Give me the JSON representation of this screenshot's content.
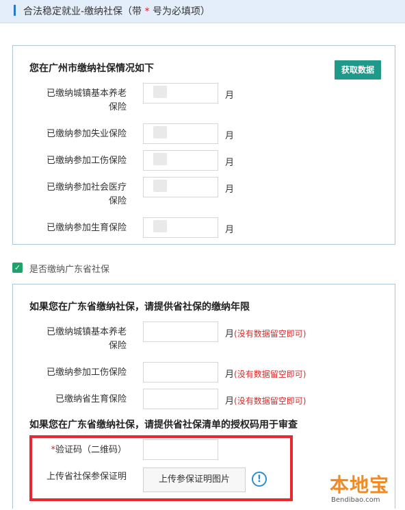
{
  "header": {
    "title_prefix": "合法稳定就业-缴纳社保（带",
    "title_star": "*",
    "title_suffix": "号为必填项）"
  },
  "guangzhou_section": {
    "title": "您在广州市缴纳社保情况如下",
    "fetch_button": "获取数据",
    "unit": "月",
    "rows": [
      {
        "label_line1": "已缴纳城镇基本养老",
        "label_line2": "保险"
      },
      {
        "label_line1": "已缴纳参加失业保险",
        "label_line2": ""
      },
      {
        "label_line1": "已缴纳参加工伤保险",
        "label_line2": ""
      },
      {
        "label_line1": "已缴纳参加社会医疗",
        "label_line2": "保险"
      },
      {
        "label_line1": "已缴纳参加生育保险",
        "label_line2": ""
      }
    ]
  },
  "province_checkbox": {
    "label": "是否缴纳广东省社保",
    "checked": true
  },
  "province_section": {
    "title": "如果您在广东省缴纳社保，请提供省社保的缴纳年限",
    "unit": "月",
    "hint": "(没有数据留空即可)",
    "rows": [
      {
        "label_line1": "已缴纳城镇基本养老",
        "label_line2": "保险"
      },
      {
        "label_line1": "已缴纳参加工伤保险",
        "label_line2": ""
      },
      {
        "label_line1": "已缴纳省生育保险",
        "label_line2": ""
      }
    ],
    "auth_title": "如果您在广东省缴纳社保，请提供省社保清单的授权码用于审查",
    "verify_star": "*",
    "verify_label": "验证码（二维码）",
    "upload_label": "上传省社保参保证明",
    "upload_button": "上传参保证明图片",
    "info_icon": "!"
  },
  "watermark": {
    "brand": "本地宝",
    "url": "Bendibao.com"
  },
  "colors": {
    "accent": "#2a78c8",
    "fetch_button": "#1f9a8a",
    "checkbox": "#22a26b",
    "highlight_box": "#e82830",
    "hint_text": "#d62b2b",
    "logo": "#ef8a26"
  }
}
